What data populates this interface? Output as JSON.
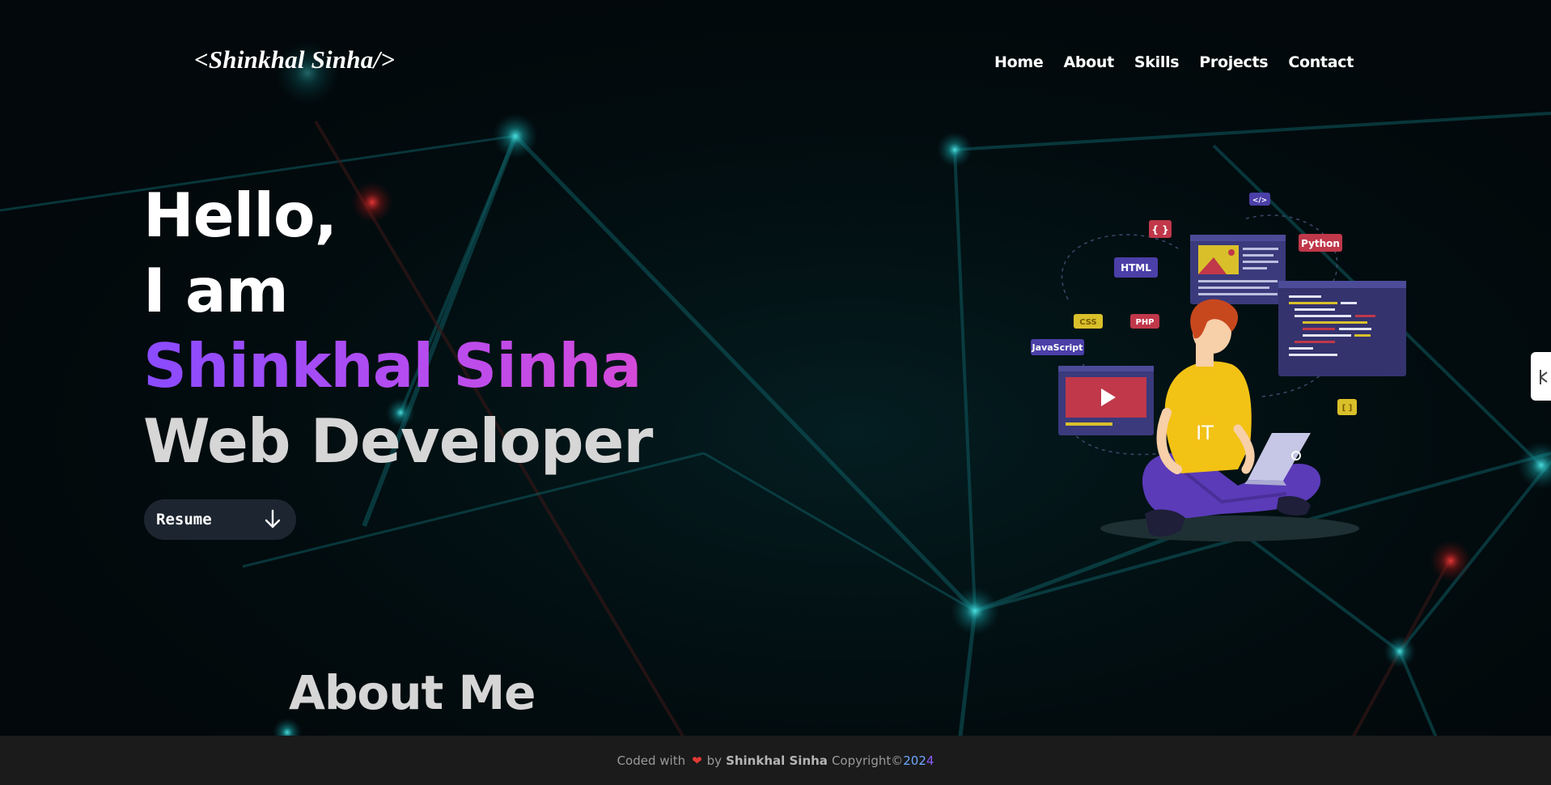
{
  "header": {
    "logo": "<Shinkhal Sinha/>",
    "nav": [
      "Home",
      "About",
      "Skills",
      "Projects",
      "Contact"
    ]
  },
  "hero": {
    "line1": "Hello,",
    "line2": "I am",
    "name": "Shinkhal Sinha",
    "role": "Web Developer",
    "resume_label": "Resume",
    "resume_icon": "arrow-down-icon"
  },
  "illustration": {
    "tags": [
      "HTML",
      "CSS",
      "PHP",
      "JavaScript",
      "Python",
      "</>",
      "{ }",
      "[ ]"
    ],
    "shirt_text": "IT"
  },
  "about": {
    "heading": "About Me"
  },
  "footer": {
    "coded_with": "Coded with",
    "heart_icon": "heart-icon",
    "by": "by",
    "author": "Shinkhal Sinha",
    "copyright": "Copyright©",
    "year_part1": "202",
    "year_part2": "4"
  },
  "colors": {
    "background": "#020d10",
    "accent_purple": "#8a4bff",
    "accent_magenta": "#d64ad8",
    "footer_bg": "#1b1b1b"
  }
}
